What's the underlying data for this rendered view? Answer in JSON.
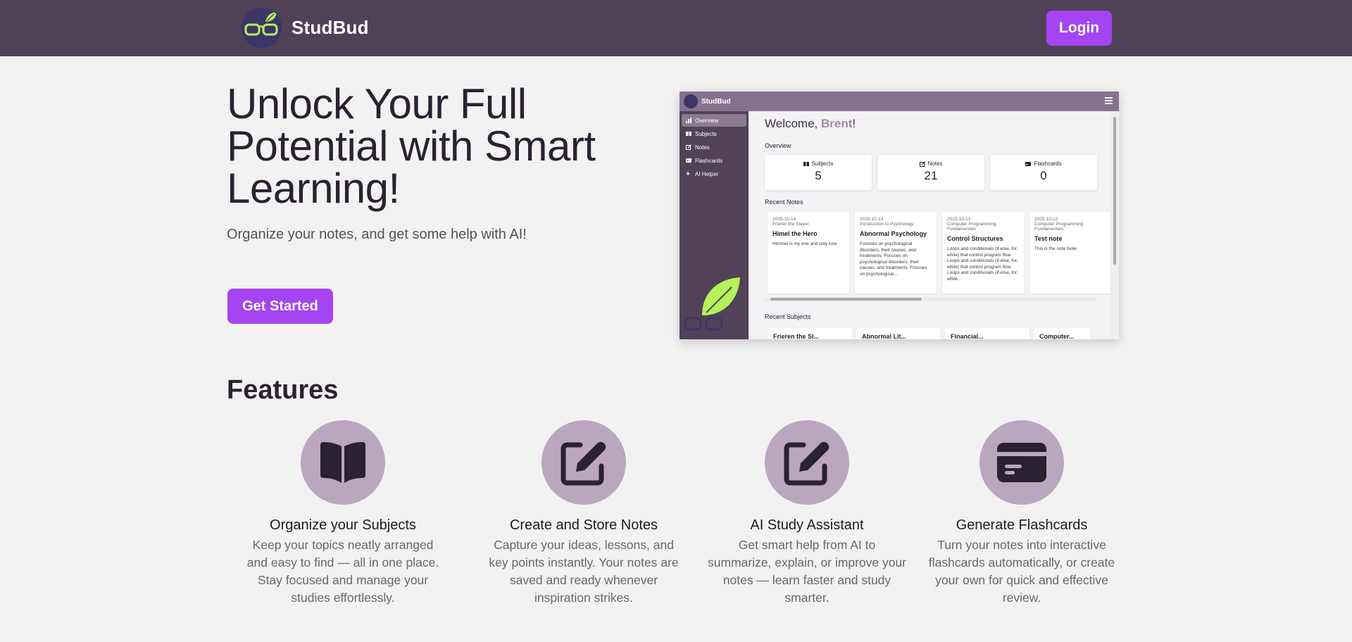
{
  "nav": {
    "brand": "StudBud",
    "login_label": "Login"
  },
  "hero": {
    "title": "Unlock Your Full Potential with Smart Learning!",
    "subtitle": "Organize your notes, and get some help with AI!",
    "cta_label": "Get Started"
  },
  "preview": {
    "brand": "StudBud",
    "sidebar": [
      {
        "label": "Overview",
        "icon": "bar-chart-icon"
      },
      {
        "label": "Subjects",
        "icon": "book-icon"
      },
      {
        "label": "Notes",
        "icon": "pencil-icon"
      },
      {
        "label": "Flashcards",
        "icon": "card-icon"
      },
      {
        "label": "AI Helper",
        "icon": "sparkle-icon"
      }
    ],
    "welcome_prefix": "Welcome, ",
    "welcome_name": "Brent",
    "welcome_suffix": "!",
    "overview_heading": "Overview",
    "stats": [
      {
        "label": "Subjects",
        "value": "5"
      },
      {
        "label": "Notes",
        "value": "21"
      },
      {
        "label": "Flashcards",
        "value": "0"
      }
    ],
    "recent_notes_heading": "Recent Notes",
    "notes": [
      {
        "date": "2025-10-14",
        "subject": "Frieren the Slayer",
        "title": "Himel the Hero",
        "body": "Himmel is my one and only love"
      },
      {
        "date": "2025-10-13",
        "subject": "Introduction to Psychology",
        "title": "Abnormal Psychology",
        "body": "Focuses on psychological disorders, their causes, and treatments. Focuses on psychological disorders, their causes, and treatments. Focuses on psychological..."
      },
      {
        "date": "2025-10-13",
        "subject": "Computer Programming Fundamentals",
        "title": "Control Structures",
        "body": "Loops and conditionals (if-else, for, while) that control program flow. Loops and conditionals (if-else, for, while) that control program flow. Loops and conditionals (if-else, for, while..."
      },
      {
        "date": "2025-10-12",
        "subject": "Computer Programming Fundamentals",
        "title": "Test note",
        "body": "This is the note foole"
      }
    ],
    "recent_subjects_heading": "Recent Subjects",
    "subjects": [
      "Frieren the Sl...",
      "Abnormal Lit...",
      "Financial...",
      "Computer..."
    ]
  },
  "features": {
    "heading": "Features",
    "items": [
      {
        "icon": "book-open-icon",
        "title": "Organize your Subjects",
        "desc": "Keep your topics neatly arranged and easy to find — all in one place. Stay focused and manage your studies effortlessly."
      },
      {
        "icon": "edit-note-icon",
        "title": "Create and Store Notes",
        "desc": "Capture your ideas, lessons, and key points instantly. Your notes are saved and ready whenever inspiration strikes."
      },
      {
        "icon": "edit-note-icon",
        "title": "AI Study Assistant",
        "desc": "Get smart help from AI to summarize, explain, or improve your notes — learn faster and study smarter."
      },
      {
        "icon": "credit-card-icon",
        "title": "Generate Flashcards",
        "desc": "Turn your notes into interactive flashcards automatically, or create your own for quick and effective review."
      }
    ]
  },
  "colors": {
    "nav_bg": "#4f4156",
    "accent": "#a444f2",
    "feature_circle": "#bba6bf",
    "leaf_green": "#b5f25a"
  }
}
